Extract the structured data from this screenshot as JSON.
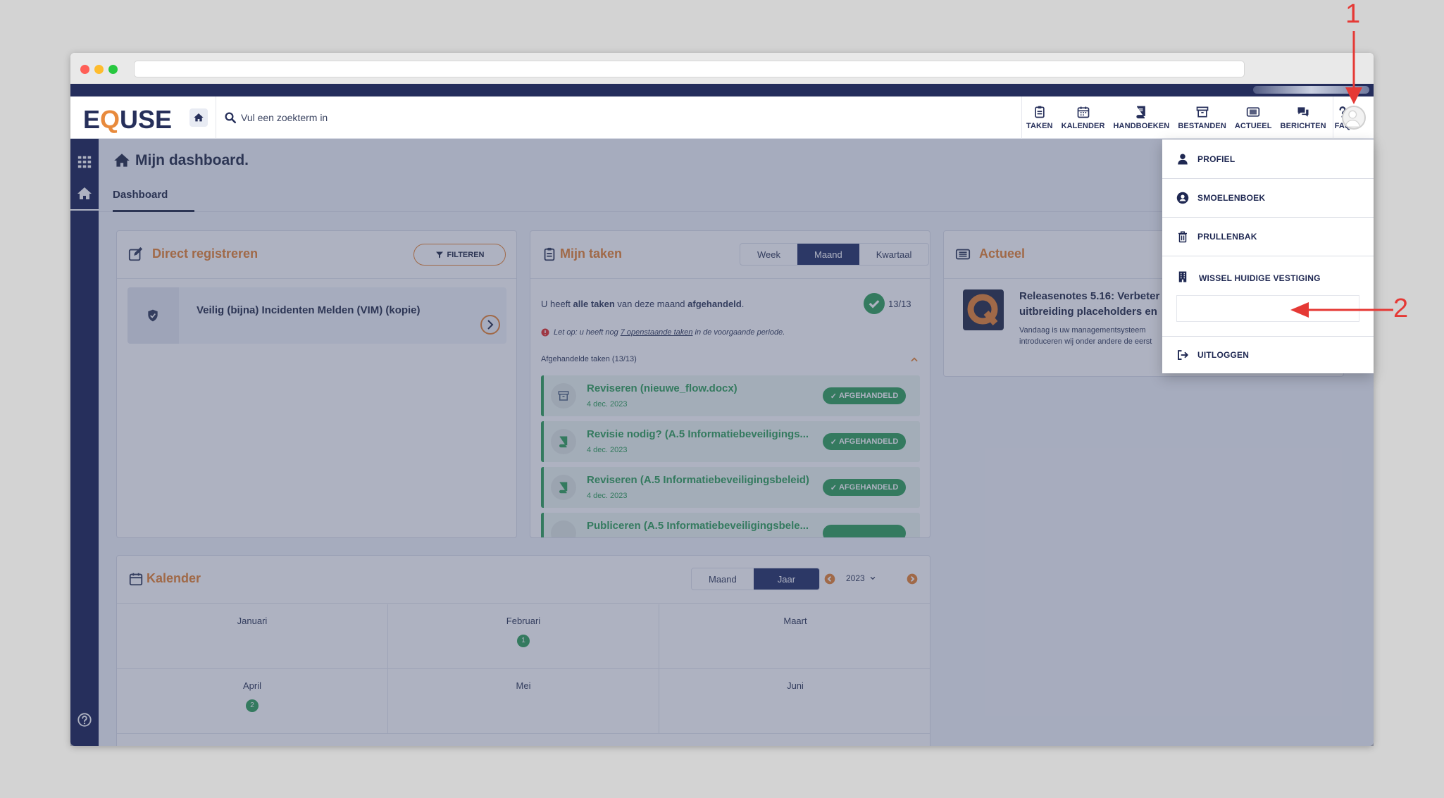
{
  "header": {
    "logo_prefix": "E",
    "logo_q": "Q",
    "logo_suffix": "USE",
    "search_placeholder": "Vul een zoekterm in"
  },
  "nav": {
    "items": [
      {
        "label": "TAKEN",
        "icon": "clipboard-icon"
      },
      {
        "label": "KALENDER",
        "icon": "calendar-icon"
      },
      {
        "label": "HANDBOEKEN",
        "icon": "book-icon"
      },
      {
        "label": "BESTANDEN",
        "icon": "archive-icon"
      },
      {
        "label": "ACTUEEL",
        "icon": "news-icon"
      },
      {
        "label": "BERICHTEN",
        "icon": "chat-icon"
      },
      {
        "label": "FAQ",
        "icon": "question-icon"
      }
    ]
  },
  "page": {
    "title": "Mijn dashboard.",
    "tab": "Dashboard"
  },
  "direct": {
    "title": "Direct registreren",
    "filter_label": "FILTEREN",
    "item": "Veilig (bijna) Incidenten Melden (VIM) (kopie)"
  },
  "taken": {
    "title": "Mijn taken",
    "periods": [
      "Week",
      "Maand",
      "Kwartaal"
    ],
    "active_period": "Maand",
    "summary_pre": "U heeft ",
    "summary_bold1": "alle taken",
    "summary_mid": " van deze maand ",
    "summary_bold2": "afgehandeld",
    "summary_end": ".",
    "count": "13/13",
    "warning_pre": "Let op: u heeft nog ",
    "warning_link": "7 openstaande taken",
    "warning_post": " in de voorgaande periode.",
    "section": "Afgehandelde taken (13/13)",
    "tasks": [
      {
        "title": "Reviseren (nieuwe_flow.docx)",
        "date": "4 dec. 2023",
        "status": "AFGEHANDELD",
        "icon": "archive-icon"
      },
      {
        "title": "Revisie nodig? (A.5 Informatiebeveiligings...",
        "date": "4 dec. 2023",
        "status": "AFGEHANDELD",
        "icon": "book-icon"
      },
      {
        "title": "Reviseren (A.5 Informatiebeveiligingsbeleid)",
        "date": "4 dec. 2023",
        "status": "AFGEHANDELD",
        "icon": "book-icon"
      },
      {
        "title": "Publiceren (A.5 Informatiebeveiligingsbele...",
        "date": "",
        "status": "",
        "icon": "book-icon"
      }
    ]
  },
  "actueel": {
    "title": "Actueel",
    "news_title_l1": "Releasenotes 5.16: Verbeter",
    "news_title_l2": "uitbreiding placeholders en",
    "news_body_l1": "Vandaag is uw managementsysteem",
    "news_body_l2": "introduceren wij onder andere de eerst"
  },
  "kalender": {
    "title": "Kalender",
    "views": [
      "Maand",
      "Jaar"
    ],
    "active_view": "Jaar",
    "year": "2023",
    "months": [
      {
        "name": "Januari",
        "count": ""
      },
      {
        "name": "Februari",
        "count": "1"
      },
      {
        "name": "Maart",
        "count": ""
      },
      {
        "name": "April",
        "count": "2"
      },
      {
        "name": "Mei",
        "count": ""
      },
      {
        "name": "Juni",
        "count": ""
      }
    ]
  },
  "dropdown": {
    "profiel": "PROFIEL",
    "smoelenboek": "SMOELENBOEK",
    "prullenbak": "PRULLENBAK",
    "vestiging": "WISSEL HUIDIGE VESTIGING",
    "uitloggen": "UITLOGGEN"
  },
  "annotations": {
    "one": "1",
    "two": "2"
  },
  "colors": {
    "navy": "#242d5c",
    "orange": "#e88a3c",
    "green": "#3aa561",
    "annotation": "#e53935"
  }
}
